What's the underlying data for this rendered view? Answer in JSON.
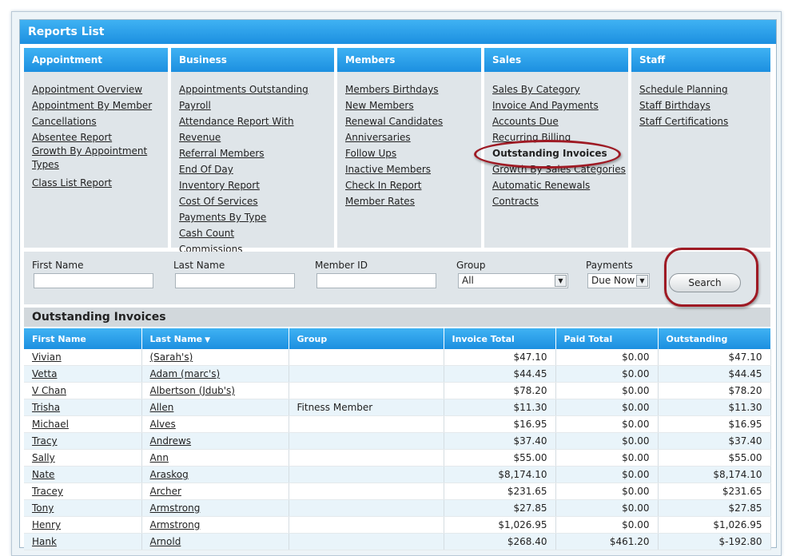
{
  "panel": {
    "title": "Reports List"
  },
  "categories": [
    {
      "name": "Appointment",
      "items": [
        "Appointment Overview",
        "Appointment By Member",
        "Cancellations",
        "Absentee Report",
        "Growth By Appointment Types",
        "Class List Report"
      ]
    },
    {
      "name": "Business",
      "items": [
        "Appointments Outstanding",
        "Payroll",
        "Attendance Report With Revenue",
        "Referral Members",
        "End Of Day",
        "Inventory Report",
        "Cost Of Services",
        "Payments By Type",
        "Cash Count",
        "Commissions"
      ]
    },
    {
      "name": "Members",
      "items": [
        "Members Birthdays",
        "New Members",
        "Renewal Candidates",
        "Anniversaries",
        "Follow Ups",
        "Inactive Members",
        "Check In Report",
        "Member Rates"
      ]
    },
    {
      "name": "Sales",
      "items": [
        "Sales By Category",
        "Invoice And Payments",
        "Accounts Due",
        "Recurring Billing",
        "Outstanding Invoices",
        "Growth By Sales Categories",
        "Automatic Renewals",
        "Contracts"
      ],
      "active": "Outstanding Invoices"
    },
    {
      "name": "Staff",
      "items": [
        "Schedule Planning",
        "Staff Birthdays",
        "Staff Certifications"
      ]
    }
  ],
  "search": {
    "first_name_label": "First Name",
    "last_name_label": "Last Name",
    "member_id_label": "Member ID",
    "group_label": "Group",
    "group_value": "All",
    "payments_label": "Payments",
    "payments_value": "Due Now",
    "button_label": "Search"
  },
  "results": {
    "title": "Outstanding Invoices",
    "columns": [
      "First Name",
      "Last Name",
      "Group",
      "Invoice Total",
      "Paid Total",
      "Outstanding"
    ],
    "sorted_column": "Last Name",
    "rows": [
      [
        "Vivian",
        "(Sarah's)",
        "",
        "$47.10",
        "$0.00",
        "$47.10"
      ],
      [
        "Vetta",
        "Adam (marc's)",
        "",
        "$44.45",
        "$0.00",
        "$44.45"
      ],
      [
        "V Chan",
        "Albertson (Jdub's)",
        "",
        "$78.20",
        "$0.00",
        "$78.20"
      ],
      [
        "Trisha",
        "Allen",
        "Fitness Member",
        "$11.30",
        "$0.00",
        "$11.30"
      ],
      [
        "Michael",
        "Alves",
        "",
        "$16.95",
        "$0.00",
        "$16.95"
      ],
      [
        "Tracy",
        "Andrews",
        "",
        "$37.40",
        "$0.00",
        "$37.40"
      ],
      [
        "Sally",
        "Ann",
        "",
        "$55.00",
        "$0.00",
        "$55.00"
      ],
      [
        "Nate",
        "Araskog",
        "",
        "$8,174.10",
        "$0.00",
        "$8,174.10"
      ],
      [
        "Tracey",
        "Archer",
        "",
        "$231.65",
        "$0.00",
        "$231.65"
      ],
      [
        "Tony",
        "Armstrong",
        "",
        "$27.85",
        "$0.00",
        "$27.85"
      ],
      [
        "Henry",
        "Armstrong",
        "",
        "$1,026.95",
        "$0.00",
        "$1,026.95"
      ],
      [
        "Hank",
        "Arnold",
        "",
        "$268.40",
        "$461.20",
        "$-192.80"
      ]
    ]
  },
  "colors": {
    "header_blue": "#1c8fe0",
    "highlight_ring": "#9e1a24",
    "panel_gray": "#dfe5e9"
  }
}
